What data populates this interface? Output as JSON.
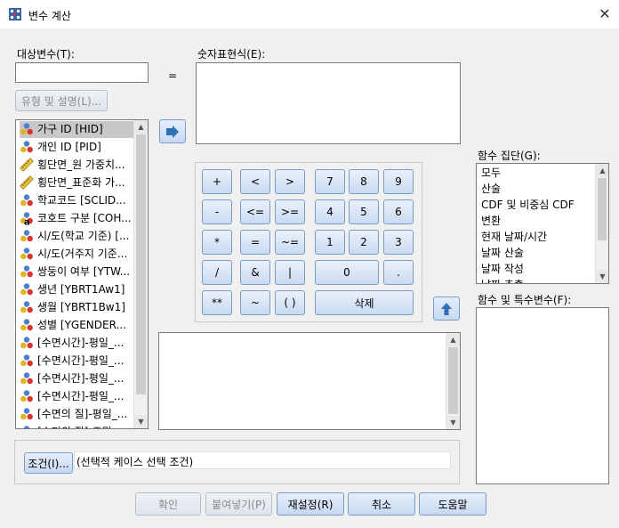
{
  "window": {
    "title": "변수 계산",
    "close_glyph": "✕"
  },
  "target_var": {
    "label": "대상변수(T):",
    "value": ""
  },
  "type_label_button": "유형 및 설명(L)...",
  "equals": "=",
  "expression": {
    "label": "숫자표현식(E):",
    "value": ""
  },
  "variables": [
    {
      "label": "가구 ID [HID]",
      "icon": "nominal-icon",
      "selected": true
    },
    {
      "label": "개인 ID [PID]",
      "icon": "nominal-icon"
    },
    {
      "label": "횡단면_원 가중치...",
      "icon": "scale-ruler-icon"
    },
    {
      "label": "횡단면_표준화 가...",
      "icon": "scale-ruler-icon"
    },
    {
      "label": "학교코드 [SCLID...",
      "icon": "nominal-icon"
    },
    {
      "label": "코호트 구분 [COH...",
      "icon": "string-nominal-icon"
    },
    {
      "label": "시/도(학교 기준) [...",
      "icon": "nominal-icon"
    },
    {
      "label": "시/도(거주지 기준...",
      "icon": "nominal-icon"
    },
    {
      "label": "쌍둥이 여부 [YTW...",
      "icon": "nominal-icon"
    },
    {
      "label": "생년 [YBRT1Aw1]",
      "icon": "nominal-icon"
    },
    {
      "label": "생월 [YBRT1Bw1]",
      "icon": "nominal-icon"
    },
    {
      "label": "성별 [YGENDER...",
      "icon": "nominal-icon"
    },
    {
      "label": "[수면시간]-평일_...",
      "icon": "nominal-icon"
    },
    {
      "label": "[수면시간]-평일_...",
      "icon": "nominal-icon"
    },
    {
      "label": "[수면시간]-평일_...",
      "icon": "nominal-icon"
    },
    {
      "label": "[수면시간]-평일_...",
      "icon": "nominal-icon"
    },
    {
      "label": "[수면의 질]-평일_...",
      "icon": "nominal-icon"
    },
    {
      "label": "[수면의 질]-주말...",
      "icon": "nominal-icon"
    }
  ],
  "keypad": {
    "k_plus": "+",
    "k_lt": "<",
    "k_gt": ">",
    "k7": "7",
    "k8": "8",
    "k9": "9",
    "k_minus": "-",
    "k_le": "<=",
    "k_ge": ">=",
    "k4": "4",
    "k5": "5",
    "k6": "6",
    "k_mul": "*",
    "k_eq": "=",
    "k_ne": "~=",
    "k1": "1",
    "k2": "2",
    "k3": "3",
    "k_div": "/",
    "k_and": "&",
    "k_or": "|",
    "k0": "0",
    "k_dot": ".",
    "k_pow": "**",
    "k_not": "~",
    "k_paren": "( )",
    "k_delete": "삭제"
  },
  "function_group": {
    "label": "함수 집단(G):",
    "items": [
      "모두",
      "산술",
      "CDF 및 비중심 CDF",
      "변환",
      "현재 날짜/시간",
      "날짜 산술",
      "날짜 작성",
      "날짜 추출"
    ]
  },
  "function_list": {
    "label": "함수 및 특수변수(F):"
  },
  "condition": {
    "button": "조건(I)...",
    "text": "(선택적 케이스 선택 조건)"
  },
  "buttons": {
    "ok": "확인",
    "paste": "붙여넣기(P)",
    "reset": "재설정(R)",
    "cancel": "취소",
    "help": "도움말"
  },
  "colors": {
    "button_border": "#7a9cc8",
    "arrow_blue": "#2f6fb6"
  }
}
